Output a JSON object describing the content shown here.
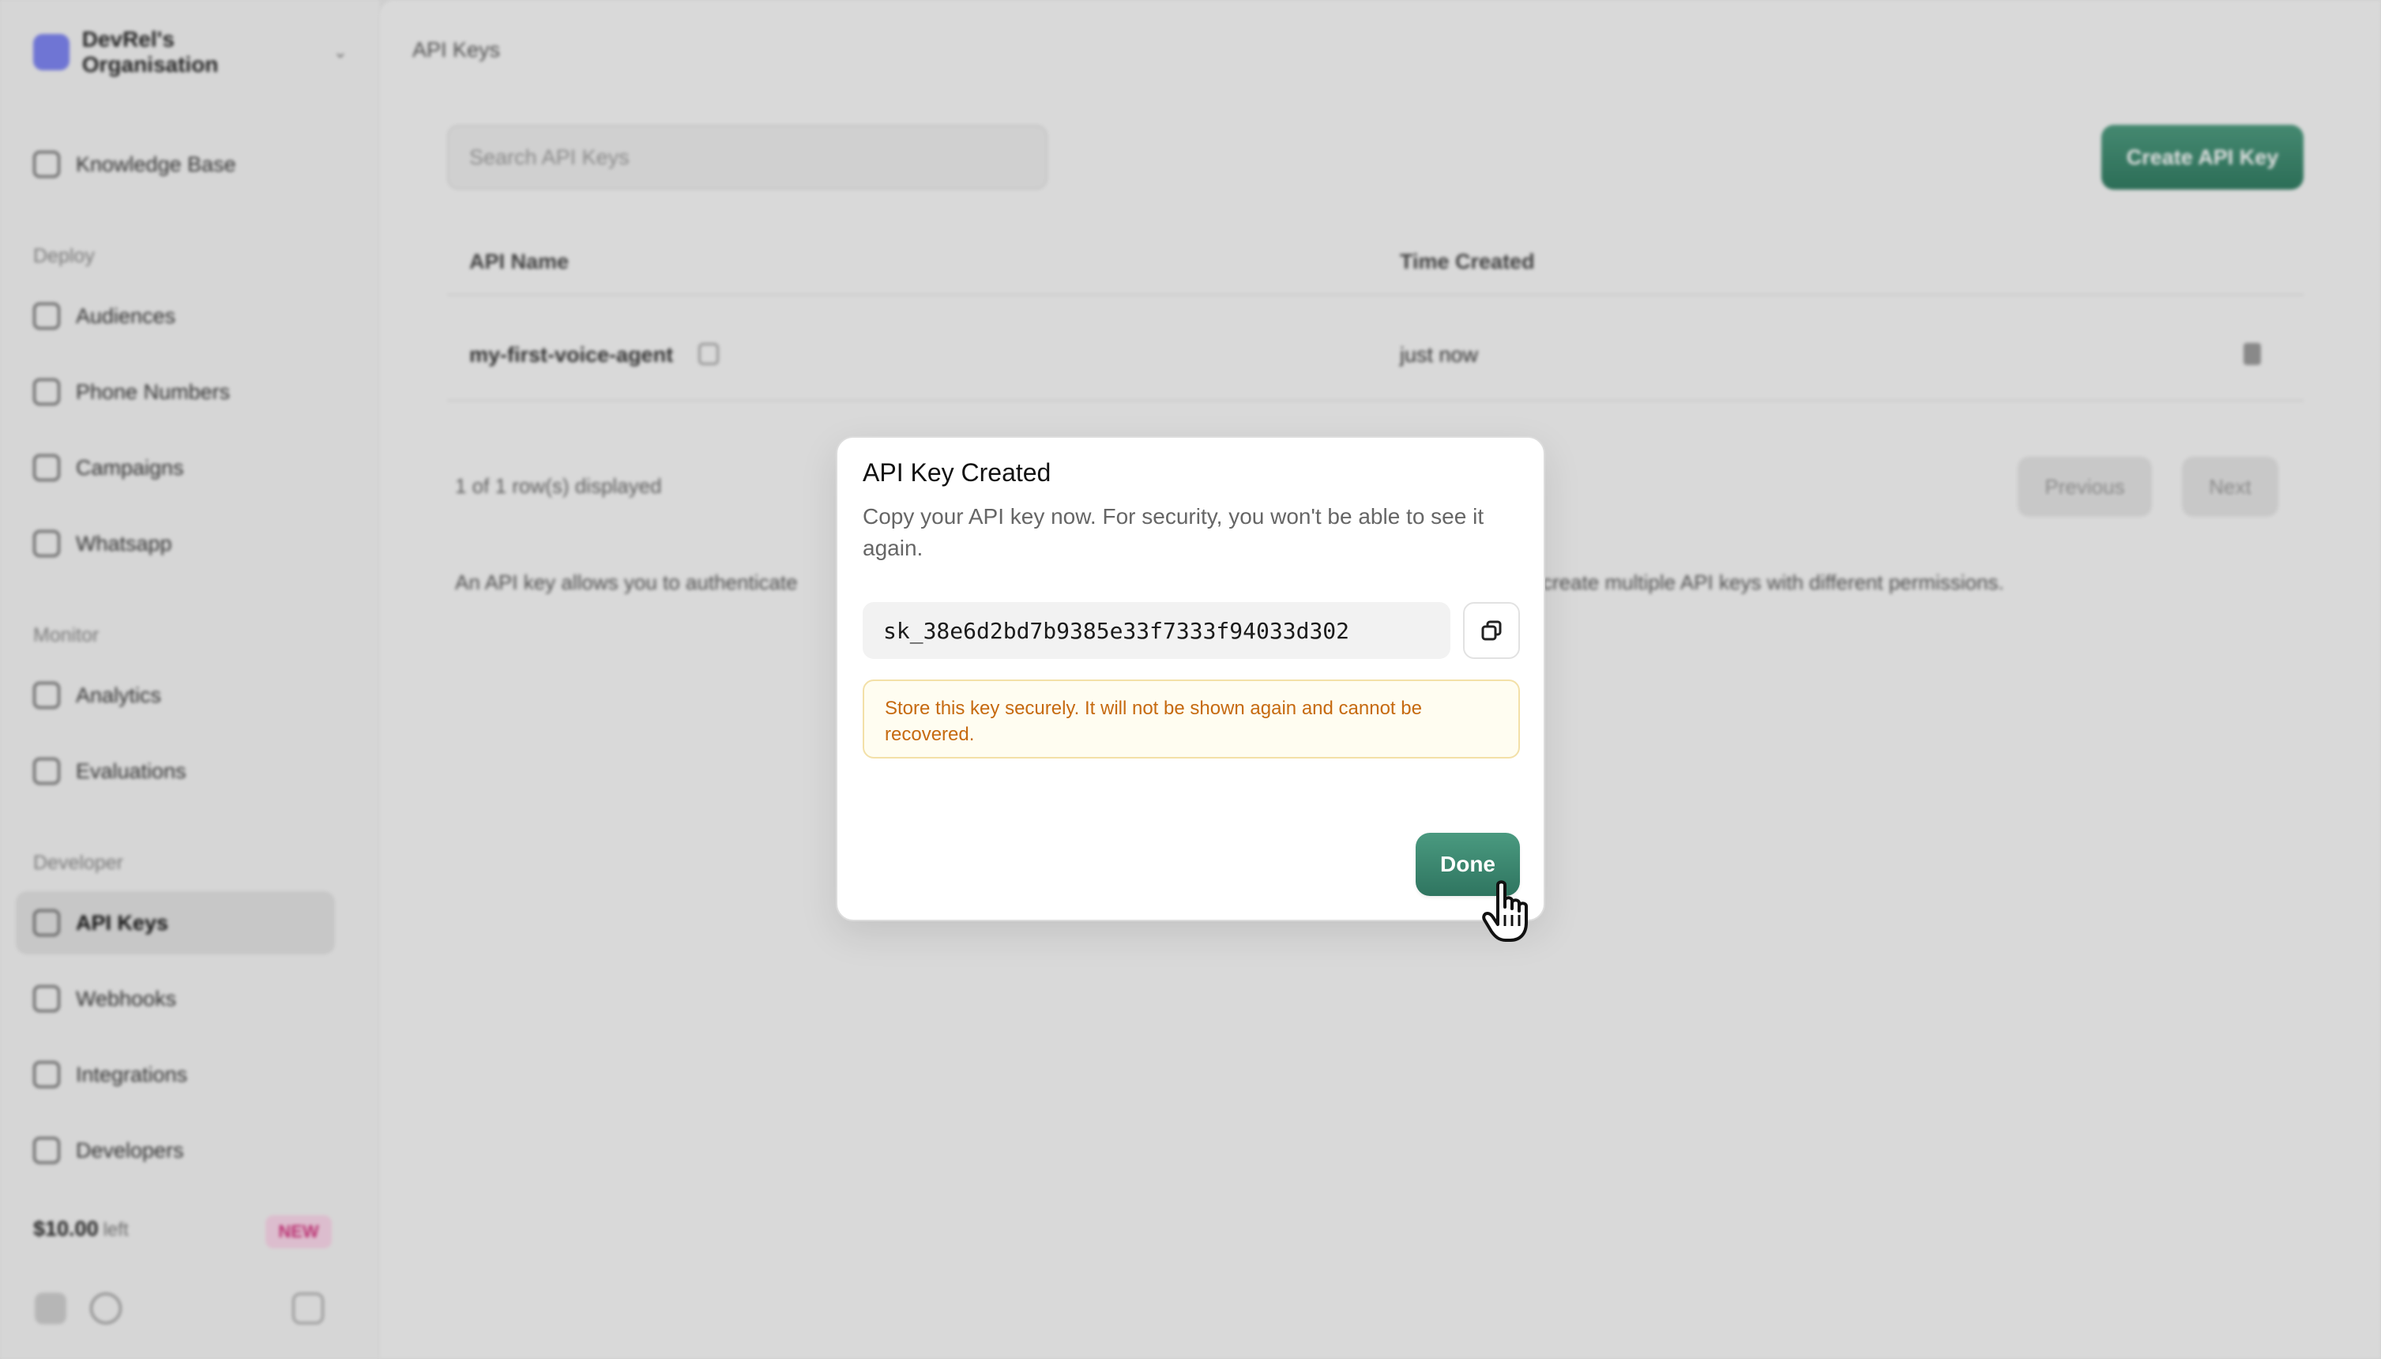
{
  "sidebar": {
    "org_name": "DevRel's Organisation",
    "items": [
      {
        "label": "Knowledge Base",
        "icon": "book-icon"
      },
      {
        "label": "Audiences",
        "icon": "users-icon"
      },
      {
        "label": "Phone Numbers",
        "icon": "phone-icon"
      },
      {
        "label": "Campaigns",
        "icon": "megaphone-icon"
      },
      {
        "label": "Whatsapp",
        "icon": "chat-icon"
      },
      {
        "label": "Analytics",
        "icon": "chart-icon"
      },
      {
        "label": "Evaluations",
        "icon": "check-icon"
      },
      {
        "label": "API Keys",
        "icon": "key-icon"
      },
      {
        "label": "Webhooks",
        "icon": "webhook-icon"
      },
      {
        "label": "Integrations",
        "icon": "plug-icon"
      },
      {
        "label": "Developers",
        "icon": "code-icon"
      }
    ],
    "sections": {
      "deploy": "Deploy",
      "monitor": "Monitor",
      "developer": "Developer"
    },
    "credit": "$10.00",
    "credit_suffix": "left",
    "new_badge": "NEW"
  },
  "main": {
    "breadcrumb": "API Keys",
    "search_placeholder": "Search API Keys",
    "create_button": "Create API Key",
    "table": {
      "headers": [
        "API Name",
        "Time Created"
      ],
      "rows": [
        {
          "name": "my-first-voice-agent",
          "created": "just now"
        }
      ]
    },
    "results_text": "1 of 1 row(s) displayed",
    "prev_label": "Previous",
    "next_label": "Next",
    "description_left": "An API key allows you to authenticate",
    "description_right": "create multiple API keys with different permissions."
  },
  "modal": {
    "title": "API Key Created",
    "subtitle": "Copy your API key now. For security, you won't be able to see it again.",
    "api_key": "sk_38e6d2bd7b9385e33f7333f94033d302",
    "warning": "Store this key securely. It will not be shown again and cannot be recovered.",
    "done_label": "Done"
  },
  "colors": {
    "accent": "#2f7560",
    "warning_text": "#c66a10",
    "warning_bg": "#fffdf1",
    "org_logo": "#7c83f2"
  }
}
